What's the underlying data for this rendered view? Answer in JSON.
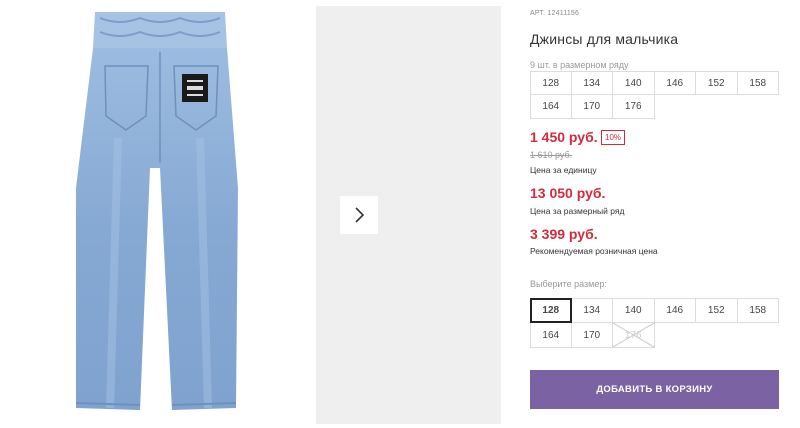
{
  "product": {
    "article": "АРТ. 12411156",
    "title": "Джинсы для мальчика",
    "stock_note": "9 шт. в размерном ряду"
  },
  "size_grid": [
    "128",
    "134",
    "140",
    "146",
    "152",
    "158",
    "164",
    "170",
    "176"
  ],
  "prices": {
    "current": "1 450 руб.",
    "discount_badge": "10%",
    "old": "1 610 руб.",
    "unit_label": "Цена за единицу",
    "row_price": "13 050 руб.",
    "row_label": "Цена за размерный ряд",
    "retail_price": "3 399 руб.",
    "retail_label": "Рекомендуемая розничная цена"
  },
  "size_select": {
    "label": "Выберите размер:",
    "options": [
      "128",
      "134",
      "140",
      "146",
      "152",
      "158",
      "164",
      "170",
      "176"
    ],
    "selected": "128",
    "unavailable": [
      "176"
    ]
  },
  "cart": {
    "add_label": "ДОБАВИТЬ В КОРЗИНУ"
  },
  "icons": {
    "next": "chevron-right-icon"
  },
  "colors": {
    "accent": "#d32c3d",
    "button": "#7b62a3",
    "jeans": "#8fb0d6"
  }
}
